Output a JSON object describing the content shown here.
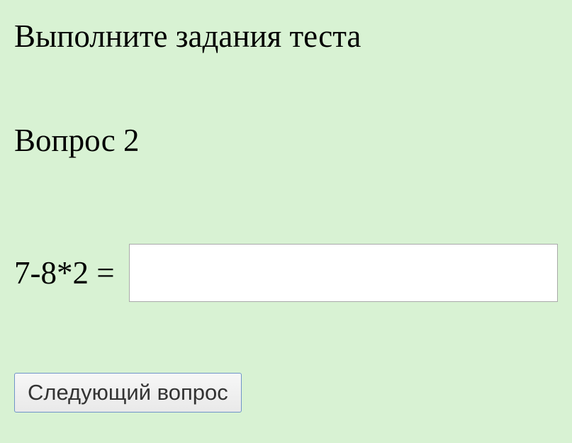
{
  "instruction": "Выполните задания теста",
  "question": {
    "label": "Вопрос 2",
    "expression": "7-8*2 =",
    "answer_value": ""
  },
  "buttons": {
    "next": "Следующий вопрос"
  }
}
